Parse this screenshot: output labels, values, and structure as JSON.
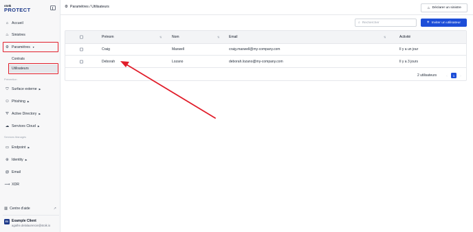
{
  "logo": {
    "small": "stoïk",
    "big": "PROTECT"
  },
  "sidebar": {
    "items": [
      {
        "label": "Accueil",
        "icon": "home-icon"
      },
      {
        "label": "Sinistres",
        "icon": "fire-icon"
      },
      {
        "label": "Paramètres",
        "icon": "gear-icon"
      },
      {
        "label": "Contrats"
      },
      {
        "label": "Utilisateurs"
      },
      {
        "label": "Surface externe",
        "icon": "shield-icon"
      },
      {
        "label": "Phishing",
        "icon": "users-icon"
      },
      {
        "label": "Active Directory",
        "icon": "directory-icon"
      },
      {
        "label": "Services Cloud",
        "icon": "cloud-icon"
      },
      {
        "label": "Endpoint",
        "icon": "laptop-icon"
      },
      {
        "label": "Identity",
        "icon": "fingerprint-icon"
      },
      {
        "label": "Email",
        "icon": "at-icon"
      },
      {
        "label": "XDR",
        "icon": "xdr-icon"
      }
    ],
    "sections": {
      "prevention": "Prévention",
      "managed": "Services Managés"
    },
    "help": "Centre d'aide",
    "user": {
      "initials": "EX",
      "name": "Example Client",
      "email": "agathe.delalaurencie@stoik.io"
    }
  },
  "header": {
    "breadcrumb": "Paramètres / Utilisateurs",
    "declare_label": "Déclarer un sinistre"
  },
  "toolbar": {
    "search_placeholder": "Rechercher",
    "invite_label": "Inviter un utilisateur"
  },
  "table": {
    "columns": [
      "Prénom",
      "Nom",
      "Email",
      "Activité"
    ],
    "rows": [
      {
        "first": "Craig",
        "last": "Maxwell",
        "email": "craig.maxwell@my-company.com",
        "activity": "Il y a un jour"
      },
      {
        "first": "Deborah",
        "last": "Lozano",
        "email": "deborah.lozano@my-company.com",
        "activity": "Il y a 3 jours"
      }
    ],
    "count_label": "2 utilisateurs",
    "page": "1"
  },
  "colors": {
    "accent": "#1d4ed8",
    "annotation": "#e11d2a",
    "brand": "#1e3a8a"
  }
}
